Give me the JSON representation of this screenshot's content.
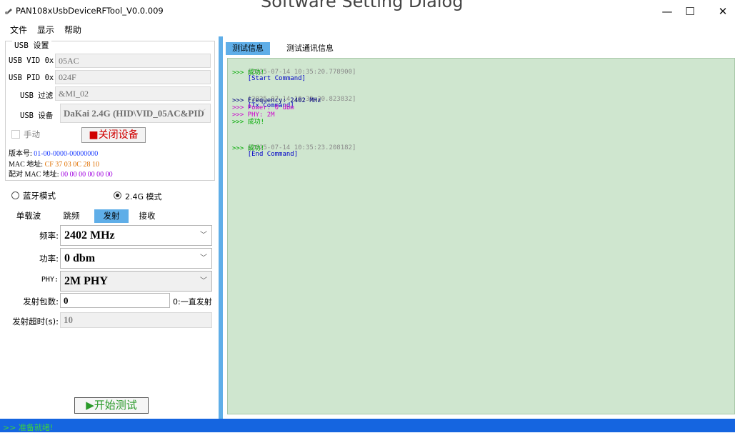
{
  "window": {
    "title": "PAN108xUsbDeviceRFTool_V0.0.009",
    "overlay_text": "Software Setting Dialog",
    "controls": {
      "minimize": "—",
      "maximize": "☐",
      "close": "✕"
    }
  },
  "menu": [
    "文件",
    "显示",
    "帮助"
  ],
  "usb_settings": {
    "legend": "USB 设置",
    "vid_label": "USB VID 0x",
    "vid_value": "05AC",
    "pid_label": "USB PID 0x",
    "pid_value": "024F",
    "filter_label": "USB 过滤",
    "filter_value": "&MI_02",
    "device_label": "USB 设备",
    "device_value": "DaKai 2.4G (HID\\VID_05AC&PID",
    "manual_label": "手动",
    "manual_checked": false,
    "close_button": "■关闭设备",
    "version_label": "版本号:",
    "version_value": "01-00-0000-00000000",
    "mac_label": "MAC 地址:",
    "mac_value": "CF 37 03 0C 28 10",
    "pair_mac_label": "配对 MAC 地址:",
    "pair_mac_value": "00 00 00 00 00 00"
  },
  "mode": {
    "bluetooth_label": "蓝牙模式",
    "g24_label": "2.4G 模式",
    "selected": "2.4G 模式"
  },
  "tabs": [
    "单载波",
    "跳频",
    "发射",
    "接收"
  ],
  "active_tab": "发射",
  "tx": {
    "freq_label": "频率:",
    "freq_value": "2402 MHz",
    "power_label": "功率:",
    "power_value": "0 dbm",
    "phy_label": "PHY:",
    "phy_value": "2M PHY",
    "count_label": "发射包数:",
    "count_value": "0",
    "count_hint": "0:一直发射",
    "timeout_label": "发射超时(s):",
    "timeout_value": "10"
  },
  "start_button": "▶开始测试",
  "right_tabs": [
    "测试信息",
    "测试通讯信息"
  ],
  "active_right_tab": "测试信息",
  "log": {
    "line1_ts": "[2025-07-14 10:35:20.778900]",
    "line1_cmd": "[Start Command]",
    "line2": ">>> 成功!",
    "line3_ts": "[2025-07-14 10:35:20.823832]",
    "line3_cmd": "[Tx Command]",
    "line4": ">>> Frequency: 2402 MHz",
    "line5": ">>> Power: 0 dbm",
    "line6": ">>> PHY: 2M",
    "line7": ">>> 成功!",
    "line8_ts": "[2025-07-14 10:35:23.208182]",
    "line8_cmd": "[End Command]",
    "line9": ">>> 成功!"
  },
  "status": ">> 准备就绪!",
  "colors": {
    "accent": "#5faee8",
    "status_bar": "#1565e0",
    "log_bg": "#cfe6cf",
    "close_text": "#d00000",
    "start_text": "#2a9a2a"
  }
}
